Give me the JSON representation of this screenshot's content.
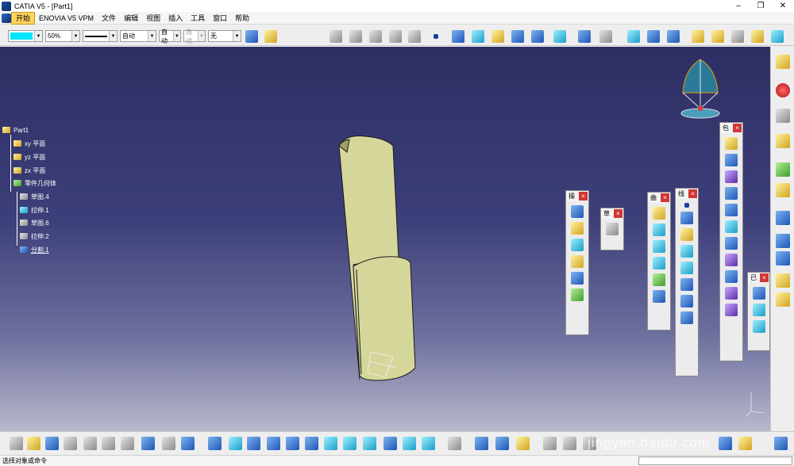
{
  "window": {
    "title": "CATIA V5 - [Part1]"
  },
  "menu": [
    "开始",
    "ENOVIA V5 VPM",
    "文件",
    "编辑",
    "视图",
    "插入",
    "工具",
    "窗口",
    "帮助"
  ],
  "properties": {
    "color_swatch": "#00e5ff",
    "transparency": "50%",
    "line_type": "",
    "line_weight": "自动",
    "point_symbol": "自动",
    "layer_label": "自动",
    "layer": "无"
  },
  "tree": {
    "root": "Part1",
    "items": [
      "xy 平面",
      "yz 平面",
      "zx 平面",
      "零件几何体",
      "草图.4",
      "拉伸.1",
      "草图.6",
      "拉伸.2",
      "分割.1"
    ]
  },
  "panels": {
    "operation": "操",
    "sketch": "草",
    "surfaces": "曲",
    "wireframe": "线",
    "volumes": "包",
    "tools": "已"
  },
  "watermark": "jingyan.baidu.com",
  "status": {
    "prompt": "选择对象或命令",
    "command_value": ""
  },
  "colors": {
    "viewport_top": "#2d2e63",
    "viewport_bottom": "#b8b8cc",
    "part_fill": "#d5d69a",
    "part_shade": "#9fa063",
    "active_menu": "#ffd35c"
  }
}
